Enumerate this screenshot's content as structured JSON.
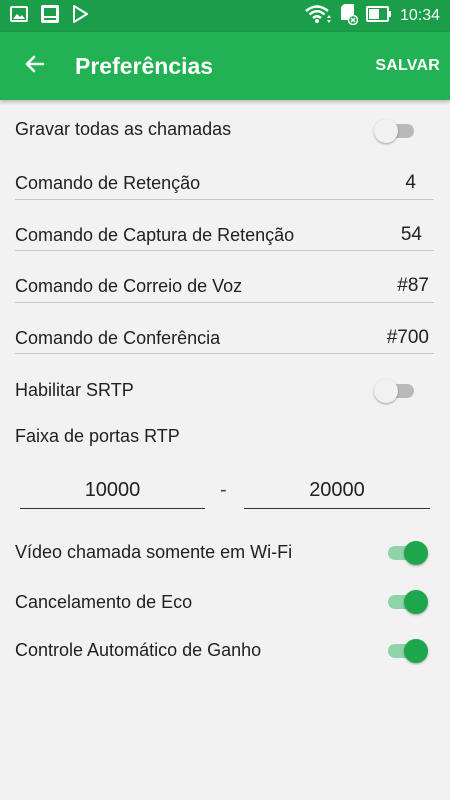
{
  "status_bar": {
    "time": "10:34",
    "icons": [
      "image-icon",
      "notification-app-icon",
      "play-store-icon",
      "wifi-icon",
      "sd-card-icon",
      "battery-icon"
    ]
  },
  "app_bar": {
    "title": "Preferências",
    "save_label": "SALVAR",
    "back_icon": "arrow-back-icon"
  },
  "colors": {
    "status_bar": "#1a9e4a",
    "app_bar": "#22b153",
    "switch_on": "#1ea64c",
    "switch_off": "#b9b9b9"
  },
  "settings": {
    "record_all_calls": {
      "label": "Gravar todas as chamadas",
      "enabled": false
    },
    "hold_command": {
      "label": "Comando de Retenção",
      "value": "4"
    },
    "hold_pickup_command": {
      "label": "Comando de Captura de Retenção",
      "value": "54"
    },
    "voicemail_command": {
      "label": "Comando de Correio de Voz",
      "value": "#87"
    },
    "conference_command": {
      "label": "Comando de Conferência",
      "value": "#700"
    },
    "enable_srtp": {
      "label": "Habilitar SRTP",
      "enabled": false
    },
    "rtp_port_range": {
      "label": "Faixa de portas RTP",
      "from": "10000",
      "separator": "-",
      "to": "20000"
    },
    "video_wifi_only": {
      "label": "Vídeo chamada somente em Wi-Fi",
      "enabled": true
    },
    "echo_cancellation": {
      "label": "Cancelamento de Eco",
      "enabled": true
    },
    "auto_gain_control": {
      "label": "Controle Automático de Ganho",
      "enabled": true
    }
  }
}
